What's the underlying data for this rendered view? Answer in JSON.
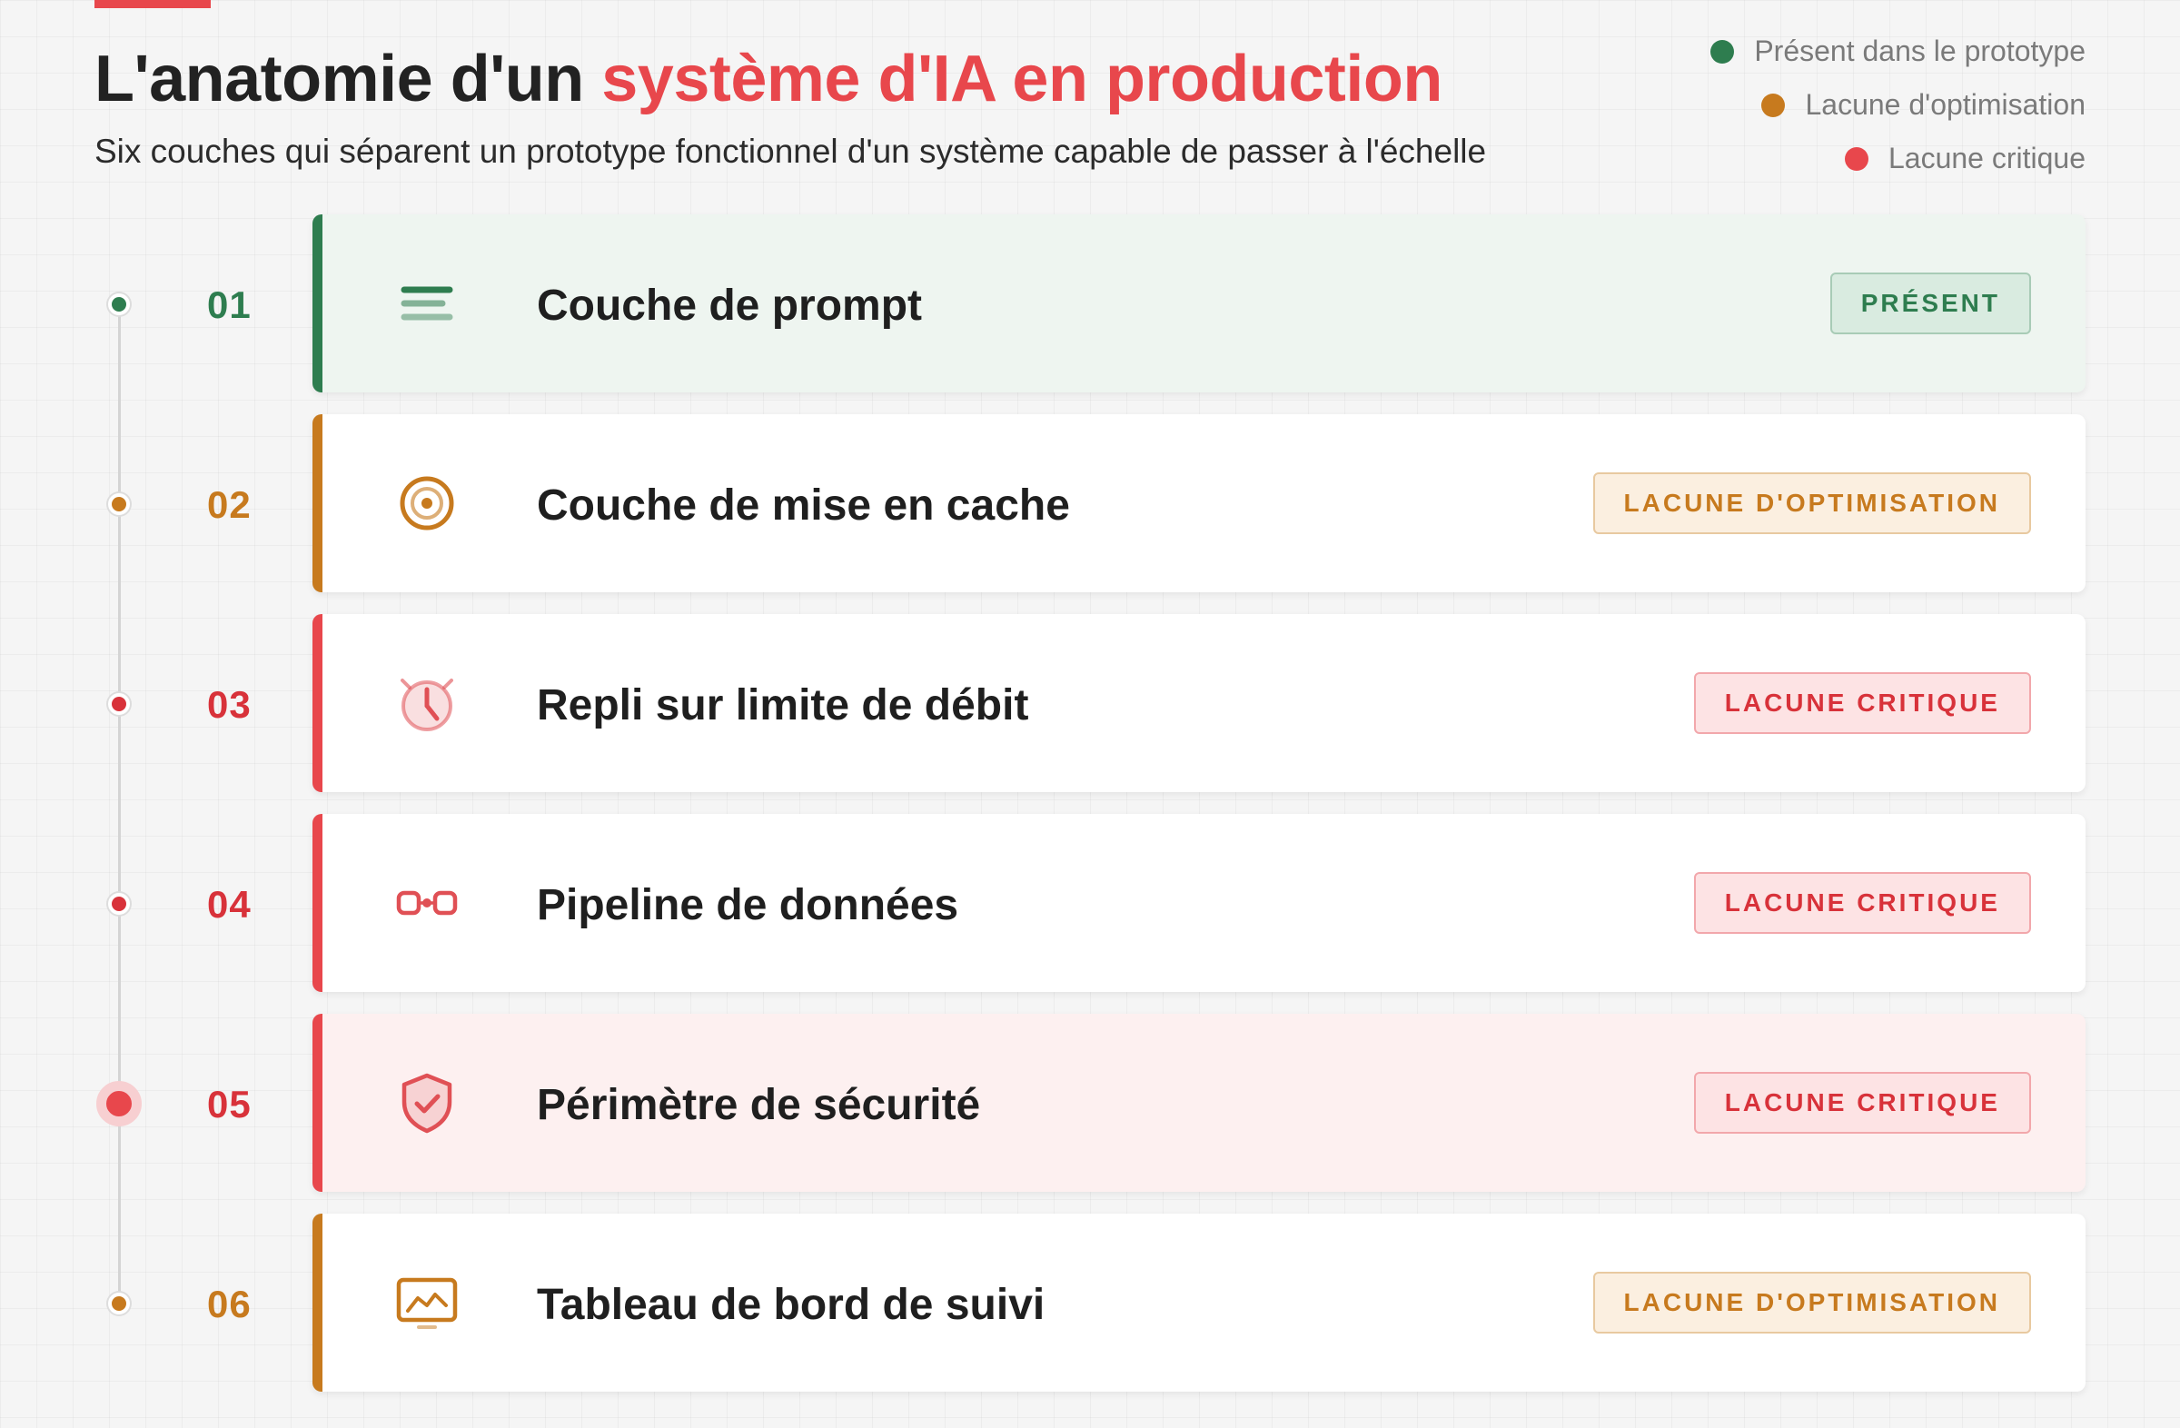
{
  "header": {
    "title_prefix": "L'anatomie d'un ",
    "title_highlight": "système d'IA en production",
    "subtitle": "Six couches qui séparent un prototype fonctionnel d'un système capable de passer à l'échelle"
  },
  "legend": [
    {
      "label": "Présent dans le prototype",
      "color": "#2e7d4f"
    },
    {
      "label": "Lacune d'optimisation",
      "color": "#c77a1e"
    },
    {
      "label": "Lacune critique",
      "color": "#e8474c"
    }
  ],
  "colors": {
    "green": "#2e7d4f",
    "orange": "#c77a1e",
    "red": "#e8474c",
    "accent": "#e8474c"
  },
  "layers": [
    {
      "number": "01",
      "title": "Couche de prompt",
      "status": "PRÉSENT",
      "status_kind": "present",
      "icon": "text-lines-icon",
      "highlighted": false
    },
    {
      "number": "02",
      "title": "Couche de mise en cache",
      "status": "LACUNE D'OPTIMISATION",
      "status_kind": "optimization",
      "icon": "target-icon",
      "highlighted": false
    },
    {
      "number": "03",
      "title": "Repli sur limite de débit",
      "status": "LACUNE CRITIQUE",
      "status_kind": "critical",
      "icon": "alarm-clock-icon",
      "highlighted": false
    },
    {
      "number": "04",
      "title": "Pipeline de données",
      "status": "LACUNE CRITIQUE",
      "status_kind": "critical",
      "icon": "pipeline-icon",
      "highlighted": false
    },
    {
      "number": "05",
      "title": "Périmètre de sécurité",
      "status": "LACUNE CRITIQUE",
      "status_kind": "critical",
      "icon": "shield-check-icon",
      "highlighted": true
    },
    {
      "number": "06",
      "title": "Tableau de bord de suivi",
      "status": "LACUNE D'OPTIMISATION",
      "status_kind": "optimization",
      "icon": "monitor-chart-icon",
      "highlighted": false
    }
  ]
}
